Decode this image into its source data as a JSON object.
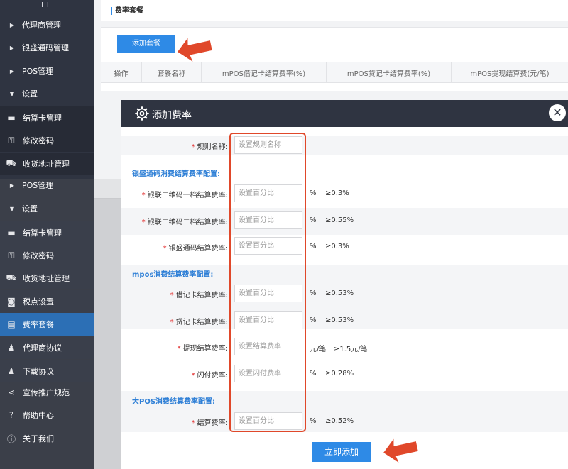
{
  "sidebar": {
    "handle_icon": "menu-handle-icon",
    "top_items": [
      {
        "label": "代理商管理",
        "icon": "arrow-right"
      },
      {
        "label": "银盛通码管理",
        "icon": "arrow-right"
      },
      {
        "label": "POS管理",
        "icon": "arrow-right"
      },
      {
        "label": "设置",
        "icon": "arrow-down"
      },
      {
        "label": "结算卡管理",
        "icon": "card-icon"
      },
      {
        "label": "修改密码",
        "icon": "key-icon"
      },
      {
        "label": "收货地址管理",
        "icon": "truck-icon"
      }
    ],
    "lower_items": [
      {
        "label": "POS管理",
        "icon": "arrow-right"
      },
      {
        "label": "设置",
        "icon": "arrow-down"
      },
      {
        "label": "结算卡管理",
        "icon": "card-icon"
      },
      {
        "label": "修改密码",
        "icon": "key-icon"
      },
      {
        "label": "收货地址管理",
        "icon": "truck-icon"
      },
      {
        "label": "税点设置",
        "icon": "tax-icon"
      },
      {
        "label": "费率套餐",
        "icon": "rate-icon",
        "active": true
      },
      {
        "label": "代理商协议",
        "icon": "bell-icon"
      },
      {
        "label": "下载协议",
        "icon": "bell-icon"
      },
      {
        "label": "宣传推广规范",
        "icon": "share-icon"
      },
      {
        "label": "帮助中心",
        "icon": "help-icon"
      },
      {
        "label": "关于我们",
        "icon": "info-icon"
      }
    ]
  },
  "page": {
    "title": "费率套餐",
    "add_package_label": "添加套餐",
    "table_headers": [
      "操作",
      "套餐名称",
      "mPOS借记卡结算费率(%)",
      "mPOS贷记卡结算费率(%)",
      "mPOS提现结算费(元/笔)"
    ]
  },
  "modal": {
    "title": "添加费率",
    "rule_name": {
      "label": "规则名称:",
      "placeholder": "设置规则名称"
    },
    "section1": "银盛通码消费结算费率配置:",
    "unionpay_qr_tier1": {
      "label": "银联二维码一档结算费率:",
      "placeholder": "设置百分比",
      "unit": "%",
      "hint": "≥0.3%"
    },
    "unionpay_qr_tier2": {
      "label": "银联二维码二档结算费率:",
      "placeholder": "设置百分比",
      "unit": "%",
      "hint": "≥0.55%"
    },
    "ysqr_rate": {
      "label": "银盛通码结算费率:",
      "placeholder": "设置百分比",
      "unit": "%",
      "hint": "≥0.3%"
    },
    "section2": "mpos消费结算费率配置:",
    "debit_rate": {
      "label": "借记卡结算费率:",
      "placeholder": "设置百分比",
      "unit": "%",
      "hint": "≥0.53%"
    },
    "credit_rate": {
      "label": "贷记卡结算费率:",
      "placeholder": "设置百分比",
      "unit": "%",
      "hint": "≥0.53%"
    },
    "withdraw_fee": {
      "label": "提现结算费率:",
      "placeholder": "设置结算费率",
      "unit": "元/笔",
      "hint": "≥1.5元/笔"
    },
    "flash_fee": {
      "label": "闪付费率:",
      "placeholder": "设置闪付费率",
      "unit": "%",
      "hint": "≥0.28%"
    },
    "section3": "大POS消费结算费率配置:",
    "settle_rate": {
      "label": "结算费率:",
      "placeholder": "设置百分比",
      "unit": "%",
      "hint": "≥0.52%"
    },
    "submit_label": "立即添加",
    "close_icon": "close-icon"
  },
  "colors": {
    "accent": "#2e8ae6",
    "sidebar_bg": "#2f3441",
    "callout": "#e0482a",
    "required": "#e02020"
  }
}
